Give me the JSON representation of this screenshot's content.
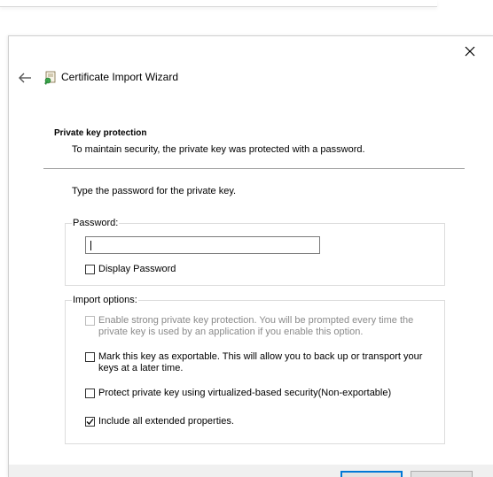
{
  "window": {
    "title": "Certificate Import Wizard",
    "icons": {
      "close": "close-icon",
      "back": "arrow-left-icon",
      "app": "certificate-wizard-icon"
    }
  },
  "header": {
    "section_title": "Private key protection",
    "section_desc": "To maintain security, the private key was protected with a password."
  },
  "main": {
    "instruction": "Type the password for the private key.",
    "password_group": {
      "label": "Password:",
      "value": "",
      "display_password": {
        "label": "Display Password",
        "checked": false
      }
    },
    "import_options": {
      "label": "Import options:",
      "options": [
        {
          "line1": "Enable strong private key protection. You will be prompted every time the",
          "line2": "private key is used by an application if you enable this option.",
          "checked": false,
          "disabled": true
        },
        {
          "line1": "Mark this key as exportable. This will allow you to back up or transport your",
          "line2": "keys at a later time.",
          "checked": false,
          "disabled": false
        },
        {
          "line1": "Protect private key using virtualized-based security(Non-exportable)",
          "line2": "",
          "checked": false,
          "disabled": false
        },
        {
          "line1": "Include all extended properties.",
          "line2": "",
          "checked": true,
          "disabled": false
        }
      ]
    }
  },
  "colors": {
    "accent": "#0078d7",
    "divider": "#a0a0a0",
    "disabled_text": "#8a8a8a"
  }
}
